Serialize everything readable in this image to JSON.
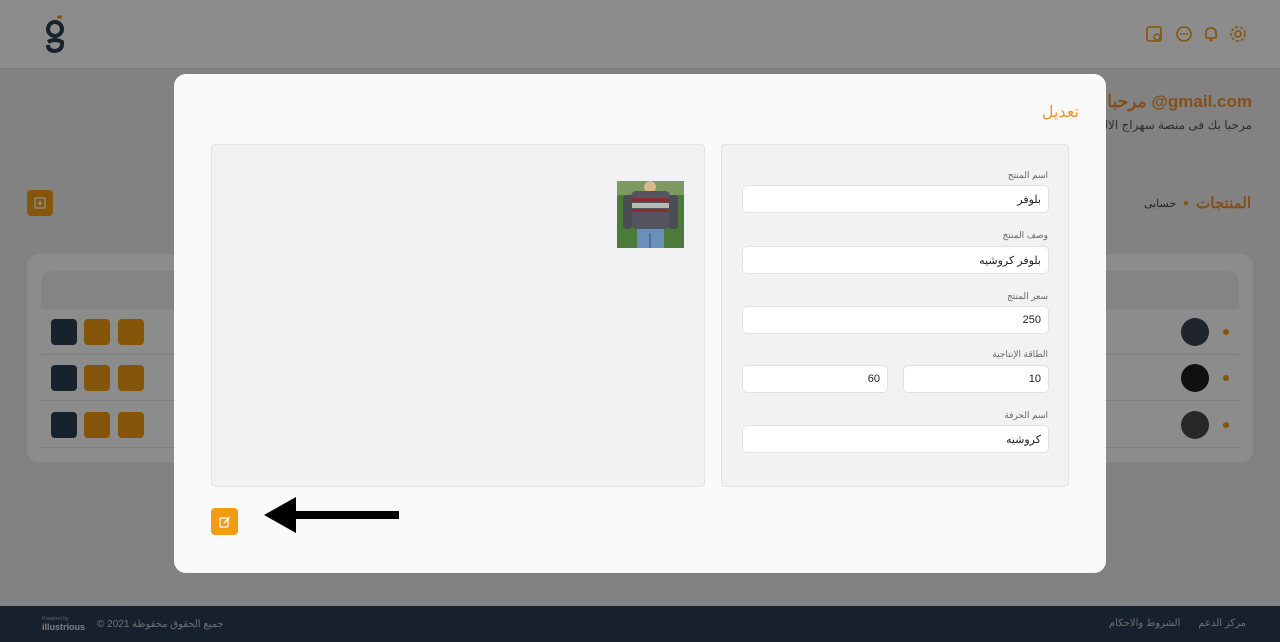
{
  "header": {
    "logo_icon": "g-letter-logo",
    "icons": [
      "settings-gear-icon",
      "bell-icon",
      "chat-icon",
      "store-icon"
    ]
  },
  "welcome": {
    "title": "مرحبا بك @gmail.com",
    "subtitle": "مرحبا بك فى منصة سهراج الالكتر"
  },
  "breadcrumb": {
    "home": "حسابى",
    "current": "المنتجات"
  },
  "modal": {
    "title": "تعديل",
    "fields": {
      "name": {
        "label": "اسم المنتج",
        "value": "بلوفر"
      },
      "description": {
        "label": "وصف المنتج",
        "value": "بلوفر كروشيه"
      },
      "price": {
        "label": "سعر المنتج",
        "value": "250"
      },
      "capacity": {
        "label": "الطاقة الإنتاجية",
        "value_a": "10",
        "value_b": "60"
      },
      "craft": {
        "label": "اسم الحرفة",
        "value": "كروشيه"
      }
    },
    "submit_icon": "edit-icon"
  },
  "footer": {
    "support": "مركز الدعم",
    "terms": "الشروط والاحكام",
    "copyright": "© 2021 جميع الحقوق محفوظة",
    "powered_by": "Powered by",
    "brand": "illustrious"
  },
  "colors": {
    "accent": "#f39c12",
    "dark": "#2c3e50",
    "footer": "#2a3d53"
  }
}
